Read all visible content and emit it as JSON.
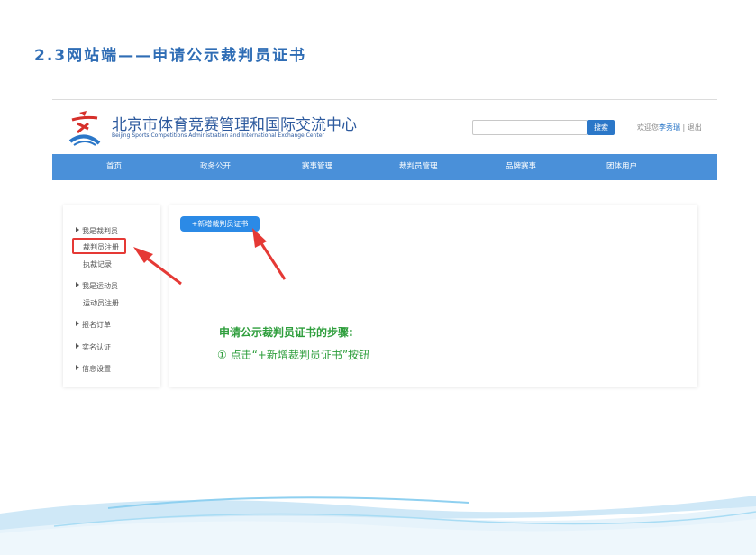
{
  "slide": {
    "title": "2.3网站端——申请公示裁判员证书"
  },
  "header": {
    "site_name_cn": "北京市体育竞赛管理和国际交流中心",
    "site_name_en": "Beijing Sports Competitions Administration and International Exchange Center",
    "search_placeholder": "",
    "search_button": "搜索",
    "welcome": "欢迎您",
    "username": "李秀瑞",
    "separator": " | ",
    "logout": "退出"
  },
  "nav": {
    "items": [
      "首页",
      "政务公开",
      "赛事管理",
      "裁判员管理",
      "品牌赛事",
      "团体用户"
    ]
  },
  "sidebar": {
    "group1": {
      "label": "我是裁判员",
      "subs": [
        "裁判员注册",
        "执裁记录"
      ]
    },
    "group2": {
      "label": "我是运动员",
      "subs": [
        "运动员注册"
      ]
    },
    "items": [
      "报名订单",
      "实名认证",
      "信息设置"
    ]
  },
  "main": {
    "add_button": "+新增裁判员证书",
    "steps_title": "申请公示裁判员证书的步骤:",
    "step1": "① 点击“+新增裁判员证书”按钮"
  },
  "colors": {
    "accent": "#2b77c8",
    "nav_bg": "#4a90d9",
    "highlight": "#e53935",
    "step_text": "#2e9e3c"
  }
}
